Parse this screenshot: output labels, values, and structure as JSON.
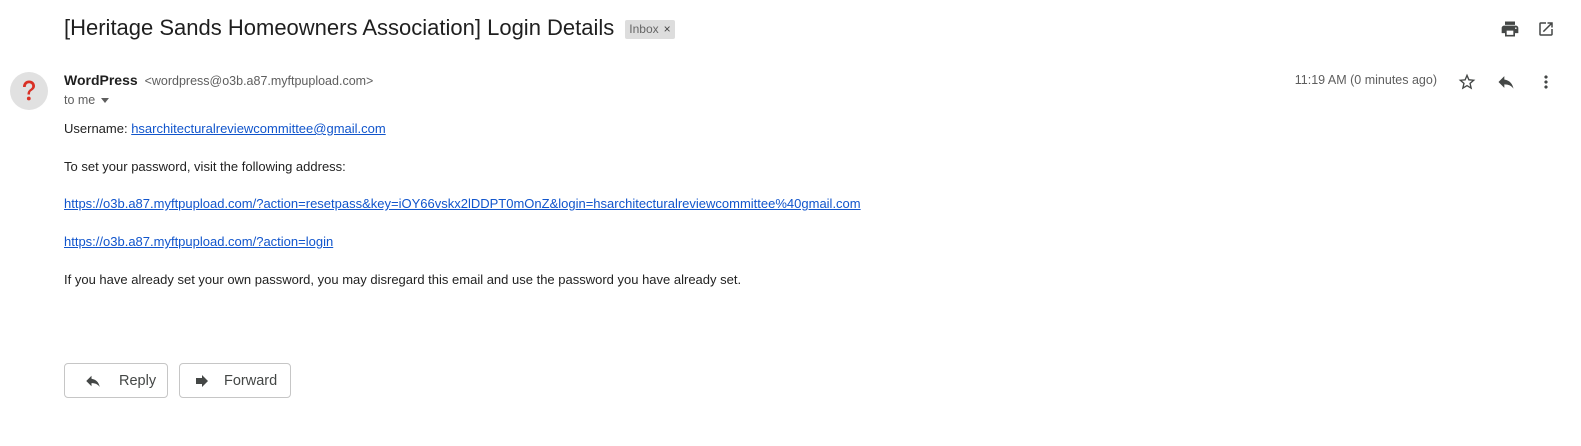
{
  "email": {
    "subject": "[Heritage Sands Homeowners Association] Login Details",
    "label": "Inbox",
    "label_remove": "×",
    "sender_name": "WordPress",
    "sender_email": "<wordpress@o3b.a87.myftpupload.com>",
    "recipient": "to me",
    "time": "11:19 AM (0 minutes ago)",
    "avatar_symbol": "?"
  },
  "body": {
    "username_label": "Username:",
    "username_value": "hsarchitecturalreviewcommittee@gmail.com",
    "instruction": "To set your password, visit the following address:",
    "reset_link": "https://o3b.a87.myftpupload.com/?action=resetpass&key=iOY66vskx2lDDPT0mOnZ&login=hsarchitecturalreviewcommittee%40gmail.com",
    "login_link": "https://o3b.a87.myftpupload.com/?action=login",
    "disclaimer": "If you have already set your own password, you may disregard this email and use the password you have already set."
  },
  "actions": {
    "reply_label": "Reply",
    "forward_label": "Forward"
  },
  "icons": {
    "print": "print-icon",
    "popout": "open-in-new-window-icon",
    "star": "star-icon",
    "reply": "reply-icon",
    "more": "more-vertical-icon",
    "forward": "forward-icon",
    "avatar": "unknown-sender-icon"
  },
  "colors": {
    "link": "#1155cc",
    "avatar_symbol": "#d93025",
    "chip_bg": "#dddddd"
  }
}
